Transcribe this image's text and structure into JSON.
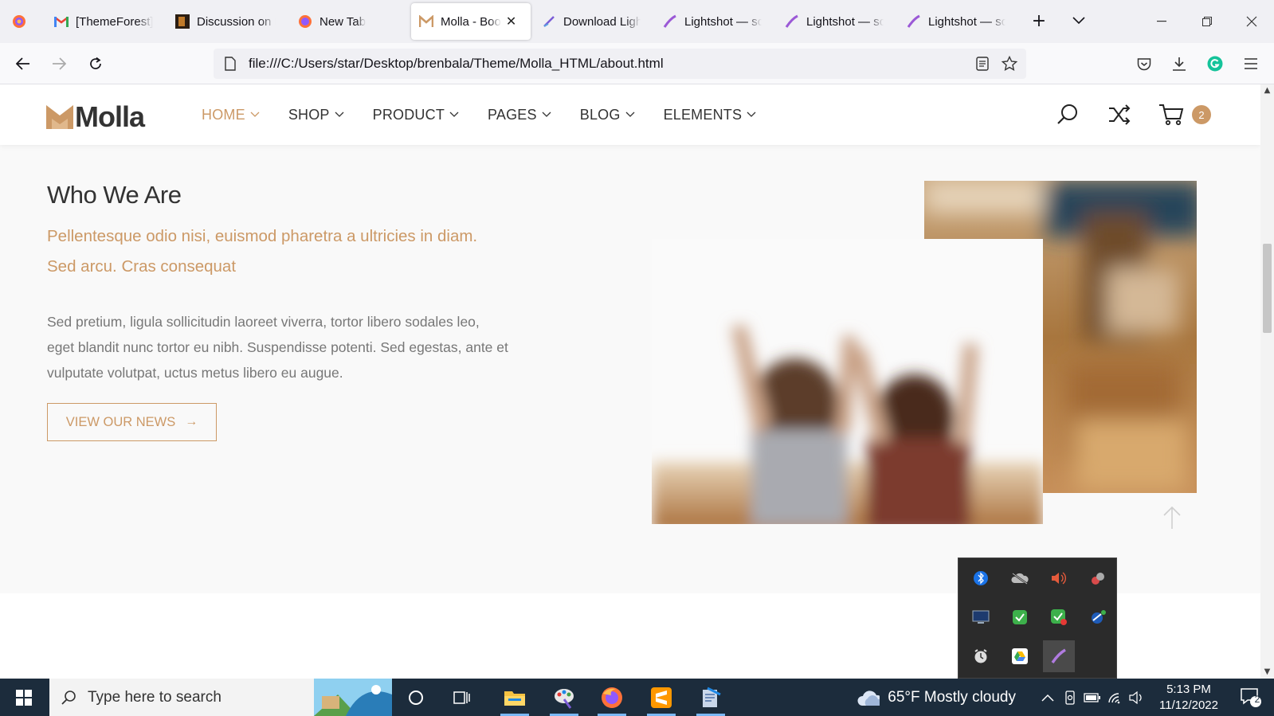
{
  "browser": {
    "tabs": [
      {
        "label": "",
        "icon": "firefox-view-icon"
      },
      {
        "label": "[ThemeForest]",
        "icon": "gmail-icon"
      },
      {
        "label": "Discussion on M",
        "icon": "site-favicon"
      },
      {
        "label": "New Tab",
        "icon": "firefox-icon"
      },
      {
        "label": "Molla - Boo",
        "icon": "molla-favicon",
        "active": true
      },
      {
        "label": "Download Ligh",
        "icon": "lightshot-icon"
      },
      {
        "label": "Lightshot — sc",
        "icon": "lightshot-feather-icon"
      },
      {
        "label": "Lightshot — sc",
        "icon": "lightshot-feather-icon"
      },
      {
        "label": "Lightshot — sc",
        "icon": "lightshot-feather-icon"
      }
    ],
    "new_tab": "+",
    "tab_list": "⌄",
    "url": "file:///C:/Users/star/Desktop/brenbala/Theme/Molla_HTML/about.html"
  },
  "site": {
    "logo_text": "Molla",
    "nav": [
      {
        "label": "HOME",
        "active": true
      },
      {
        "label": "SHOP"
      },
      {
        "label": "PRODUCT"
      },
      {
        "label": "PAGES"
      },
      {
        "label": "BLOG"
      },
      {
        "label": "ELEMENTS"
      }
    ],
    "cart_count": "2",
    "accent_color": "#cc9966"
  },
  "about": {
    "title": "Who We Are",
    "lead": "Pellentesque odio nisi, euismod pharetra a ultricies in diam. Sed arcu. Cras consequat",
    "body": "Sed pretium, ligula sollicitudin laoreet viverra, tortor libero sodales leo, eget blandit nunc tortor eu nibh. Suspendisse potenti. Sed egestas, ante et vulputate volutpat, uctus metus libero eu augue.",
    "button": "VIEW OUR NEWS",
    "button_arrow": "→"
  },
  "tray_icons": [
    "bluetooth-icon",
    "onedrive-offline-icon",
    "volume-icon",
    "app-tray-icon",
    "display-icon",
    "security-check-icon",
    "security-alert-icon",
    "network-app-icon",
    "clock-app-icon",
    "google-drive-icon",
    "lightshot-icon"
  ],
  "taskbar": {
    "search_placeholder": "Type here to search",
    "weather": "65°F  Mostly cloudy",
    "time": "5:13 PM",
    "date": "11/12/2022",
    "notification_count": "2"
  }
}
